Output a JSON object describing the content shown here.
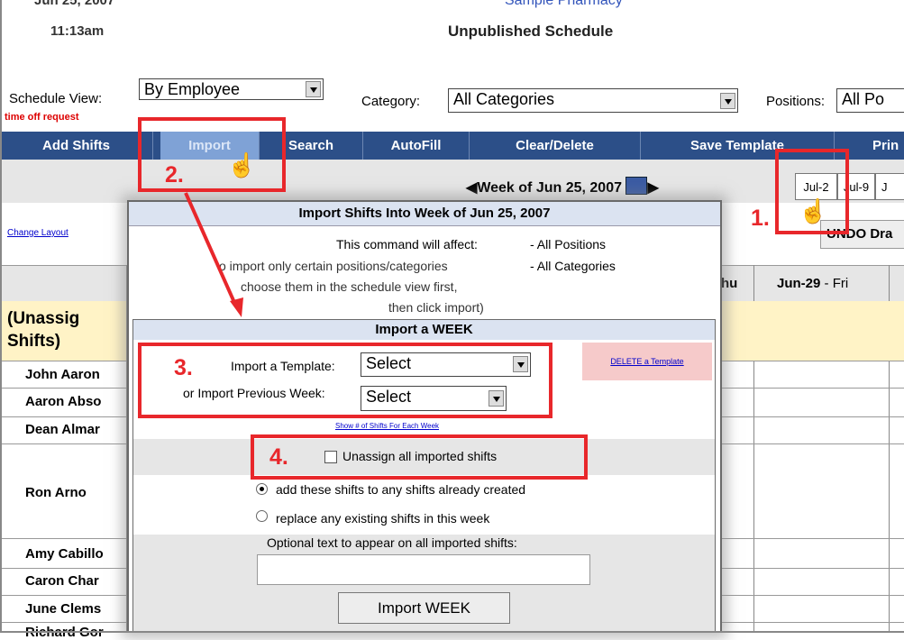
{
  "header": {
    "date_cut": "Jun 25, 2007",
    "time": "11:13am",
    "pharmacy_cut": "Sample Pharmacy",
    "status": "Unpublished Schedule"
  },
  "controls": {
    "schedule_view_label": "Schedule View:",
    "schedule_view_value": "By Employee",
    "category_label": "Category:",
    "category_value": "All Categories",
    "positions_label": "Positions:",
    "positions_value": "All Po",
    "time_off": "time off request"
  },
  "navbar": {
    "add_shifts": "Add Shifts",
    "import": "Import",
    "search": "Search",
    "autofill": "AutoFill",
    "clear_delete": "Clear/Delete",
    "save_template": "Save Template",
    "print_cut": "Prin"
  },
  "week": {
    "label": "Week of Jun 25, 2007",
    "jul2": "Jul-2",
    "jul9": "Jul-9",
    "j_cut": "J"
  },
  "grid": {
    "change_layout": "Change Layout",
    "undo": "UNDO Dra",
    "thu_cut": "hu",
    "fri_date": "Jun-29",
    "fri_day": " - Fri",
    "unassigned_line1": "(Unassig",
    "unassigned_line2": "Shifts)",
    "employees": [
      "John Aaron",
      "Aaron Abso",
      "Dean Almar",
      "Ron Arno",
      "Amy Cabillo",
      "Caron Char",
      "June Clems",
      "Richard Gor"
    ]
  },
  "dialog": {
    "title": "Import Shifts Into Week of Jun 25, 2007",
    "affect_line1": "This command will affect:",
    "affect_line2": "o import only certain positions/categories",
    "affect_line3": "choose them in the schedule view first,",
    "affect_line4": "then click import)",
    "affect_val1": "- All Positions",
    "affect_val2": "- All Categories",
    "sub_title": "Import a WEEK",
    "template_label": "Import a Template:",
    "template_value": "Select",
    "prev_week_label": "or Import Previous Week:",
    "prev_week_value": "Select",
    "delete_template": "DELETE a Template",
    "show_link": "Show # of Shifts For Each Week",
    "unassign_label": "Unassign all imported shifts",
    "radio_add": "add these shifts to any shifts already created",
    "radio_replace": "replace any existing shifts in this week",
    "optional_label": "Optional text to appear on all imported shifts:",
    "import_button": "Import WEEK"
  },
  "callouts": {
    "n1": "1.",
    "n2": "2.",
    "n3": "3.",
    "n4": "4."
  },
  "colors": {
    "navbar": "#2c4f88",
    "callout_red": "#e8272b",
    "dialog_title_bg": "#dbe3f1",
    "unassigned_bg": "#fff3c6"
  }
}
